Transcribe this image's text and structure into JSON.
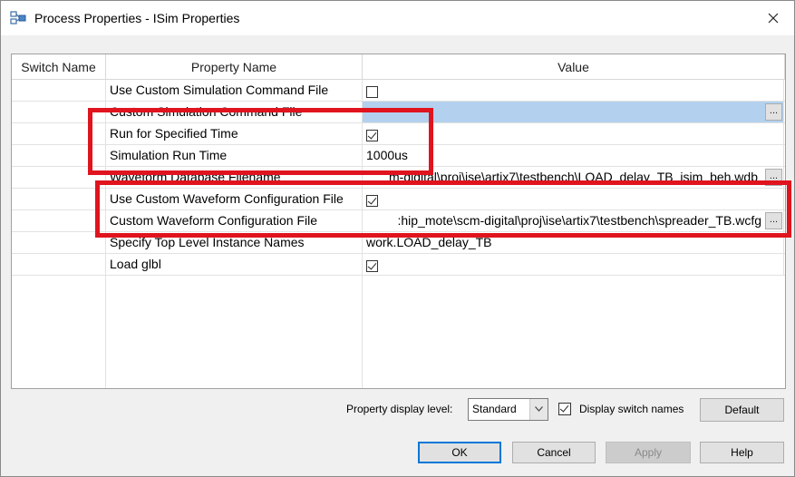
{
  "window": {
    "title": "Process Properties - ISim Properties"
  },
  "icons": {
    "app": "process-properties-icon",
    "close": "close-icon",
    "dropdown": "chevron-down-icon",
    "check": "checkmark-icon"
  },
  "grid": {
    "headers": {
      "switch": "Switch Name",
      "property": "Property Name",
      "value": "Value"
    },
    "rows": [
      {
        "name": "Use Custom Simulation Command File",
        "type": "checkbox",
        "checked": false,
        "value": ""
      },
      {
        "name": "Custom Simulation Command File",
        "type": "file",
        "selected": true,
        "value": ""
      },
      {
        "name": "Run for Specified Time",
        "type": "checkbox",
        "checked": true,
        "value": ""
      },
      {
        "name": "Simulation Run Time",
        "type": "text",
        "value": "1000us"
      },
      {
        "name": "Waveform Database Filename",
        "type": "file",
        "value": "m-digital\\proj\\ise\\artix7\\testbench\\LOAD_delay_TB_isim_beh.wdb"
      },
      {
        "name": "Use Custom Waveform Configuration File",
        "type": "checkbox",
        "checked": true,
        "value": ""
      },
      {
        "name": "Custom Waveform Configuration File",
        "type": "file",
        "value": ":hip_mote\\scm-digital\\proj\\ise\\artix7\\testbench\\spreader_TB.wcfg"
      },
      {
        "name": "Specify Top Level Instance Names",
        "type": "text",
        "value": "work.LOAD_delay_TB"
      },
      {
        "name": "Load glbl",
        "type": "checkbox",
        "checked": true,
        "value": ""
      }
    ]
  },
  "bottom": {
    "display_level_label": "Property display level:",
    "display_level_value": "Standard",
    "display_switch_label": "Display switch names",
    "display_switch_checked": true,
    "default_label": "Default",
    "ok_label": "OK",
    "cancel_label": "Cancel",
    "apply_label": "Apply",
    "help_label": "Help"
  },
  "colors": {
    "highlight": "#e0141e",
    "selection": "#b3d1ef",
    "focus": "#0078d7"
  }
}
